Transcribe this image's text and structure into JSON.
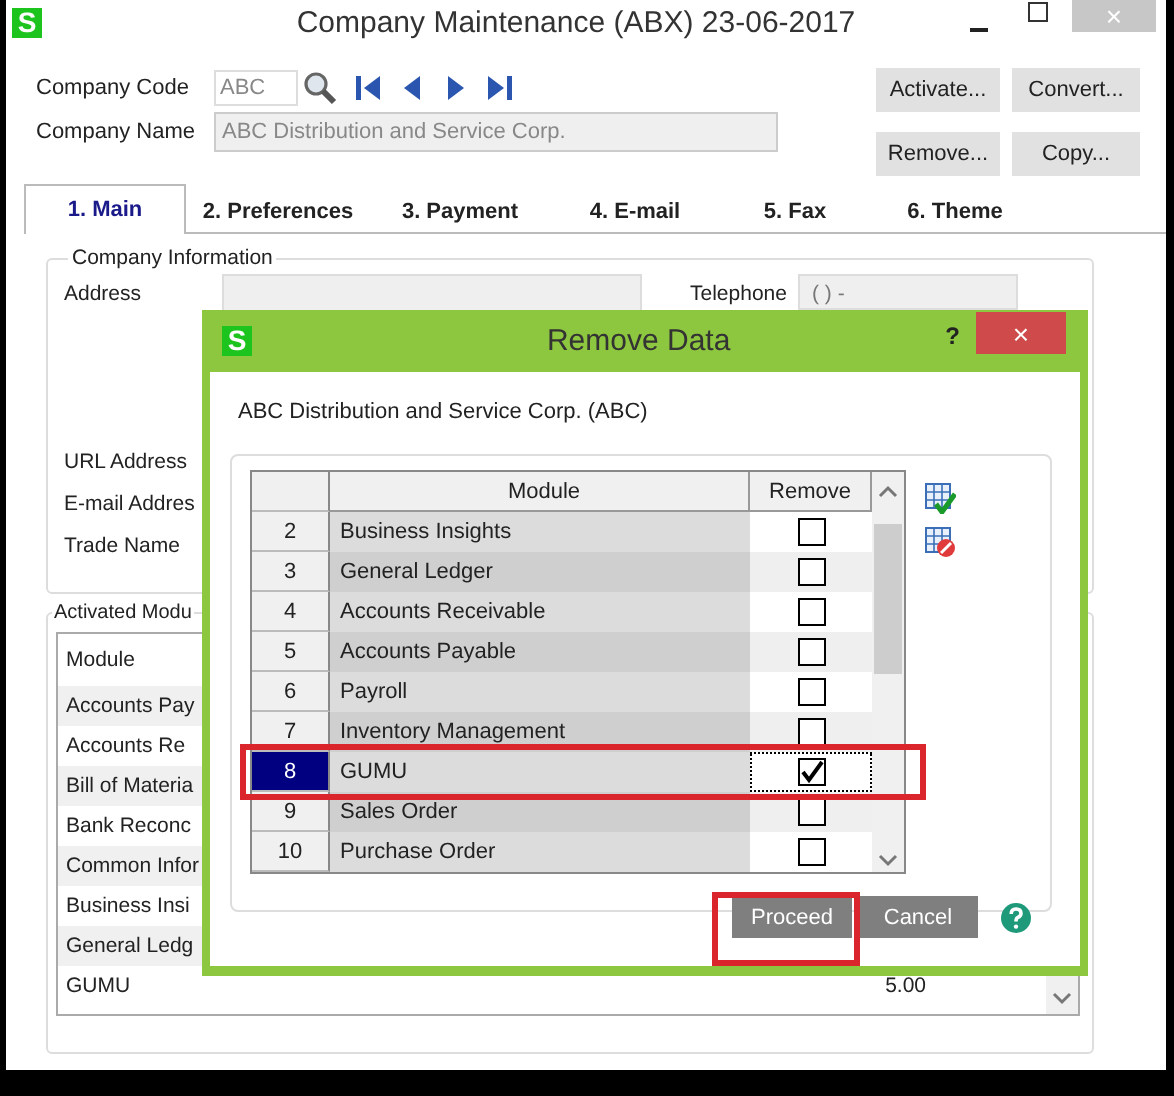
{
  "window": {
    "app_icon": "S",
    "title": "Company Maintenance (ABX) 23-06-2017",
    "close": "×"
  },
  "company_code": {
    "label": "Company Code",
    "value": "ABC"
  },
  "company_name": {
    "label": "Company Name",
    "value": "ABC Distribution and Service Corp."
  },
  "buttons": [
    "Activate...",
    "Convert...",
    "Remove...",
    "Copy..."
  ],
  "tabs": [
    {
      "label": "1. Main",
      "selected": true
    },
    {
      "label": "2. Preferences",
      "selected": false
    },
    {
      "label": "3. Payment",
      "selected": false
    },
    {
      "label": "4. E-mail",
      "selected": false
    },
    {
      "label": "5. Fax",
      "selected": false
    },
    {
      "label": "6. Theme",
      "selected": false
    }
  ],
  "company_information": {
    "title": "Company Information",
    "labels": [
      "Address",
      "URL Address",
      "E-mail Addres",
      "Trade Name"
    ],
    "telephone": {
      "label": "Telephone",
      "value": "(  )   -"
    }
  },
  "activated_modules": {
    "title": "Activated Modu",
    "header": "Module",
    "rows": [
      {
        "module": "Accounts Pay"
      },
      {
        "module": "Accounts Re"
      },
      {
        "module": "Bill of Materia"
      },
      {
        "module": "Bank Reconc"
      },
      {
        "module": "Common Infor"
      },
      {
        "module": "Business Insi"
      },
      {
        "module": "General Ledg"
      },
      {
        "module": "GUMU",
        "column_2": "5.00"
      }
    ]
  },
  "dialog": {
    "app_icon": "S",
    "title": "Remove Data",
    "help": "?",
    "close": "×",
    "company": "ABC Distribution and Service Corp. (ABC)",
    "columns": [
      "Module",
      "Remove"
    ],
    "rows": [
      {
        "number": "2",
        "module": "Business Insights",
        "remove": false,
        "selected": false
      },
      {
        "number": "3",
        "module": "General Ledger",
        "remove": false,
        "selected": false
      },
      {
        "number": "4",
        "module": "Accounts Receivable",
        "remove": false,
        "selected": false
      },
      {
        "number": "5",
        "module": "Accounts Payable",
        "remove": false,
        "selected": false
      },
      {
        "number": "6",
        "module": "Payroll",
        "remove": false,
        "selected": false
      },
      {
        "number": "7",
        "module": "Inventory Management",
        "remove": false,
        "selected": false
      },
      {
        "number": "8",
        "module": "GUMU",
        "remove": true,
        "selected": true
      },
      {
        "number": "9",
        "module": "Sales Order",
        "remove": false,
        "selected": false
      },
      {
        "number": "10",
        "module": "Purchase Order",
        "remove": false,
        "selected": false
      }
    ],
    "buttons": [
      "Proceed",
      "Cancel"
    ]
  }
}
